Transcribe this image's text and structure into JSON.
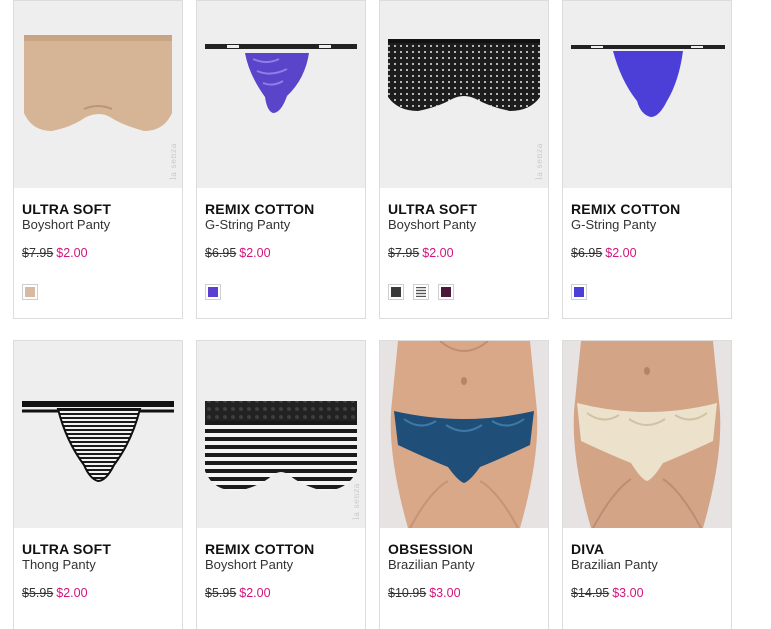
{
  "products": [
    {
      "title": "ULTRA SOFT",
      "subtitle": "Boyshort Panty",
      "old_price": "$7.95",
      "price": "$2.00",
      "swatches": [
        "#d8b9a2"
      ],
      "watermark": "la senza"
    },
    {
      "title": "REMIX COTTON",
      "subtitle": "G-String Panty",
      "old_price": "$6.95",
      "price": "$2.00",
      "swatches": [
        "#5a3fd0"
      ]
    },
    {
      "title": "ULTRA SOFT",
      "subtitle": "Boyshort Panty",
      "old_price": "$7.95",
      "price": "$2.00",
      "swatches": [
        "#3a3a3a",
        "striped",
        "#4a1838"
      ],
      "watermark": "la senza"
    },
    {
      "title": "REMIX COTTON",
      "subtitle": "G-String Panty",
      "old_price": "$6.95",
      "price": "$2.00",
      "swatches": [
        "#4c3fd8"
      ]
    },
    {
      "title": "ULTRA SOFT",
      "subtitle": "Thong Panty",
      "old_price": "$5.95",
      "price": "$2.00"
    },
    {
      "title": "REMIX COTTON",
      "subtitle": "Boyshort Panty",
      "old_price": "$5.95",
      "price": "$2.00",
      "watermark": "la senza"
    },
    {
      "title": "OBSESSION",
      "subtitle": "Brazilian Panty",
      "old_price": "$10.95",
      "price": "$3.00"
    },
    {
      "title": "DIVA",
      "subtitle": "Brazilian Panty",
      "old_price": "$14.95",
      "price": "$3.00"
    }
  ],
  "colors": {
    "sale_price": "#d2147e",
    "card_border": "#dcdcdc",
    "image_bg": "#eeeeee"
  }
}
